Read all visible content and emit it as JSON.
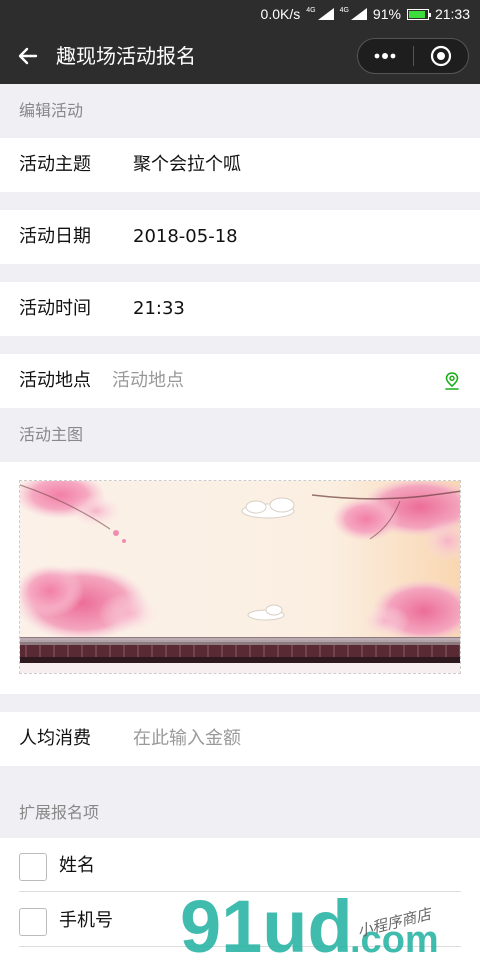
{
  "status_bar": {
    "speed": "0.0K/s",
    "net1": "4G",
    "net2": "4G",
    "battery": "91%",
    "battery_level": 0.91,
    "time": "21:33"
  },
  "nav": {
    "title": "趣现场活动报名",
    "back_icon": "arrow-left-icon",
    "more_icon": "more-dots-icon",
    "close_icon": "target-circle-icon"
  },
  "sections": {
    "edit": "编辑活动",
    "main_image": "活动主图",
    "extend": "扩展报名项"
  },
  "fields": {
    "topic": {
      "label": "活动主题",
      "value": "聚个会拉个呱"
    },
    "date": {
      "label": "活动日期",
      "value": "2018-05-18"
    },
    "time": {
      "label": "活动时间",
      "value": "21:33"
    },
    "location": {
      "label": "活动地点",
      "placeholder": "活动地点",
      "icon": "location-pin-icon"
    },
    "fee": {
      "label": "人均消费",
      "placeholder": "在此输入金额"
    }
  },
  "extend_items": [
    {
      "label": "姓名",
      "checked": false
    },
    {
      "label": "手机号",
      "checked": false
    }
  ],
  "watermark": {
    "brand": "91ud",
    "domain": ".com",
    "tagline": "小程序商店"
  },
  "colors": {
    "header": "#2d2d2d",
    "background": "#efeff4",
    "location_icon": "#1aad19",
    "watermark_teal": "#2bb5a5"
  }
}
